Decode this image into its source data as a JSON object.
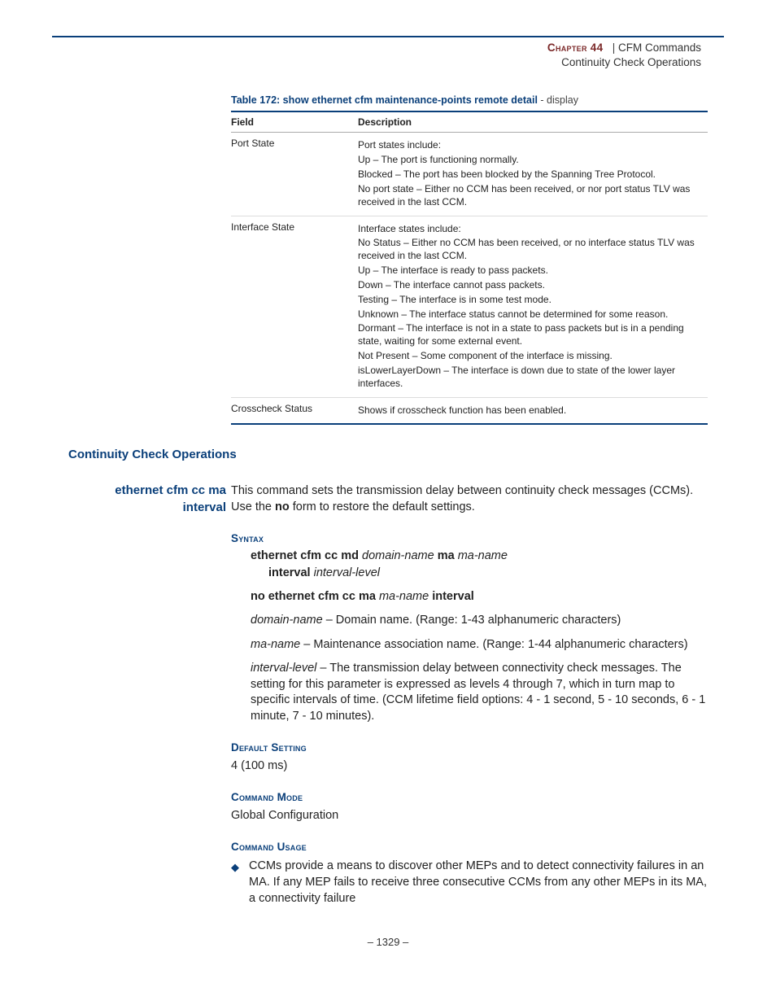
{
  "header": {
    "chapter_label": "Chapter 44",
    "separator": "|",
    "chapter_title": "  CFM Commands",
    "subtitle": "Continuity Check Operations"
  },
  "table": {
    "title_prefix": "Table 172: show ethernet cfm maintenance-points remote detail",
    "title_suffix": " - display",
    "head_field": "Field",
    "head_desc": "Description",
    "rows": [
      {
        "field": "Port State",
        "lines": [
          "Port states include:",
          "Up – The port is functioning normally.",
          "Blocked – The port has been blocked by the Spanning Tree Protocol.",
          "No port state – Either no CCM has been received, or nor port status TLV was received in the last CCM."
        ]
      },
      {
        "field": "Interface State",
        "lines": [
          "Interface states include:",
          "No Status – Either no CCM has been received, or no interface status TLV was received in the last CCM.",
          "Up – The interface is ready to pass packets.",
          "Down – The interface cannot pass packets.",
          "Testing – The interface is in some test mode.",
          "Unknown – The interface status cannot be determined for some reason.",
          "Dormant – The interface is not in a state to pass packets but is in a pending state, waiting for some external event.",
          "Not Present – Some component of the interface is missing.",
          "isLowerLayerDown – The interface is down due to state of the lower layer interfaces."
        ]
      },
      {
        "field": "Crosscheck Status",
        "lines": [
          "Shows if crosscheck function has been enabled."
        ]
      }
    ]
  },
  "section_heading": "Continuity Check Operations",
  "command": {
    "name_line1": "ethernet cfm cc ma",
    "name_line2": "interval",
    "intro_a": "This command sets the transmission delay between continuity check messages (CCMs). Use the ",
    "intro_no": "no",
    "intro_b": " form to restore the default settings."
  },
  "syntax": {
    "heading": "Syntax",
    "line1_a": "ethernet cfm cc md ",
    "line1_b": "domain-name",
    "line1_c": " ma ",
    "line1_d": "ma-name",
    "line2_a": "interval ",
    "line2_b": "interval-level",
    "no_a": "no ethernet cfm cc ma ",
    "no_b": "ma-name",
    "no_c": " interval",
    "param1_a": "domain-name",
    "param1_b": " – Domain name. (Range: 1-43 alphanumeric characters)",
    "param2_a": "ma-name",
    "param2_b": " – Maintenance association name. (Range: 1-44 alphanumeric characters)",
    "param3_a": "interval-level",
    "param3_b": " – The transmission delay between connectivity check messages. The setting for this parameter is expressed as levels 4 through 7, which in turn map to specific intervals of time. (CCM lifetime field options: 4 - 1 second, 5 - 10 seconds, 6 - 1 minute, 7 - 10 minutes)."
  },
  "default_setting": {
    "heading": "Default Setting",
    "value": "4 (100 ms)"
  },
  "command_mode": {
    "heading": "Command Mode",
    "value": "Global Configuration"
  },
  "command_usage": {
    "heading": "Command Usage",
    "items": [
      "CCMs provide a means to discover other MEPs and to detect connectivity failures in an MA. If any MEP fails to receive three consecutive CCMs from any other MEPs in its MA, a connectivity failure"
    ]
  },
  "page_number": "–  1329  –"
}
